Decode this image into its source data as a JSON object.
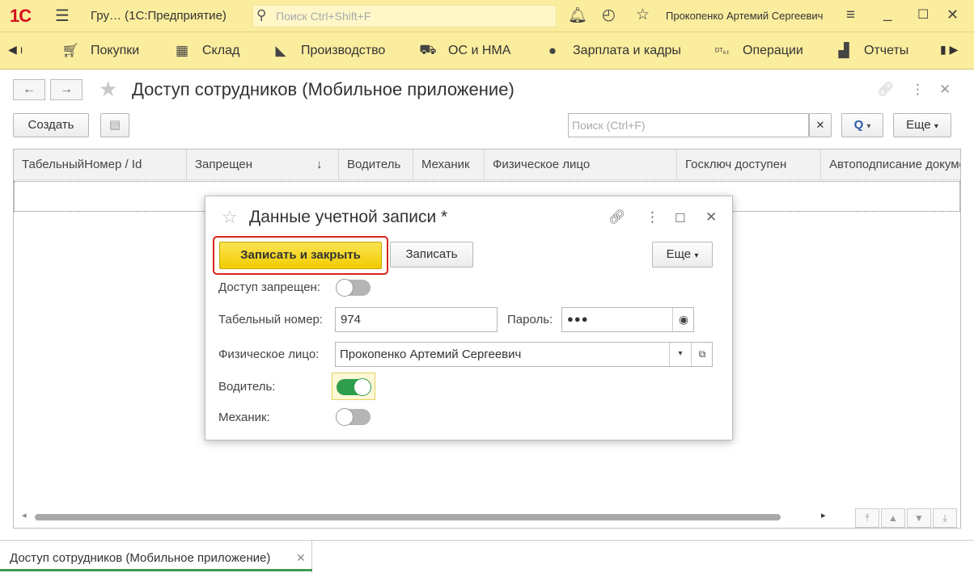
{
  "titlebar": {
    "logo": "1С",
    "app_title": "Гру…  (1С:Предприятие)",
    "search_placeholder": "Поиск Ctrl+Shift+F",
    "user": "Прокопенко Артемий Сергеевич"
  },
  "sections": [
    {
      "label": "Покупки",
      "icon": "cart-icon"
    },
    {
      "label": "Склад",
      "icon": "warehouse-icon"
    },
    {
      "label": "Производство",
      "icon": "factory-icon"
    },
    {
      "label": "ОС и НМА",
      "icon": "truck-icon"
    },
    {
      "label": "Зарплата и кадры",
      "icon": "person-icon"
    },
    {
      "label": "Операции",
      "icon": "dt-kt-icon"
    },
    {
      "label": "Отчеты",
      "icon": "bar-chart-icon"
    }
  ],
  "form": {
    "title": "Доступ сотрудников (Мобильное приложение)",
    "create_label": "Создать",
    "search_placeholder": "Поиск (Ctrl+F)",
    "more_label": "Еще",
    "search_btn_label": "Q",
    "columns": [
      "ТабельныйНомер / Id",
      "Запрещен",
      "Водитель",
      "Механик",
      "Физическое лицо",
      "Госключ доступен",
      "Автоподписание документов"
    ],
    "sort_indicator": "↓"
  },
  "dialog": {
    "title": "Данные учетной записи *",
    "save_close_label": "Записать и закрыть",
    "save_label": "Записать",
    "more_label": "Еще",
    "access_denied_label": "Доступ запрещен:",
    "access_denied": false,
    "tab_number_label": "Табельный номер:",
    "tab_number": "974",
    "password_label": "Пароль:",
    "password_mask": "●●●",
    "person_label": "Физическое лицо:",
    "person": "Прокопенко Артемий Сергеевич",
    "driver_label": "Водитель:",
    "driver": true,
    "mechanic_label": "Механик:",
    "mechanic": false
  },
  "bottom_tab": {
    "label": "Доступ сотрудников (Мобильное приложение)"
  },
  "colors": {
    "brand_yellow": "#fbed9e",
    "primary_button": "#f5d409",
    "highlight_red": "#d9241c",
    "toggle_on": "#2e9d4c"
  }
}
